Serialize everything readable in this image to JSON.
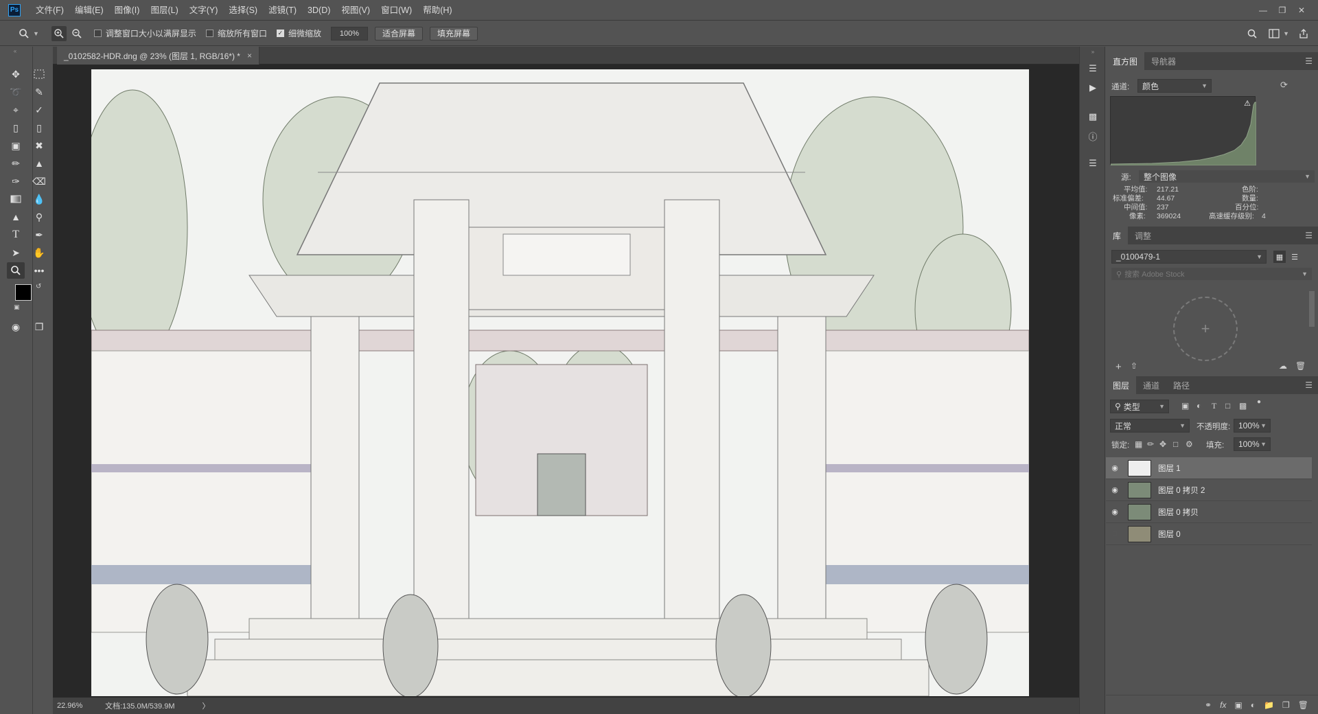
{
  "app": {
    "logo": "Ps"
  },
  "menubar": {
    "items": [
      "文件(F)",
      "编辑(E)",
      "图像(I)",
      "图层(L)",
      "文字(Y)",
      "选择(S)",
      "滤镜(T)",
      "3D(D)",
      "视图(V)",
      "窗口(W)",
      "帮助(H)"
    ]
  },
  "options": {
    "resize_windows": "调整窗口大小以满屏显示",
    "zoom_all": "缩放所有窗口",
    "scrubby_zoom": "细微缩放",
    "zoom_value": "100%",
    "fit_screen": "适合屏幕",
    "fill_screen": "填充屏幕"
  },
  "document": {
    "tab_title": "_0102582-HDR.dng @ 23% (图层 1, RGB/16*) *",
    "close": "×"
  },
  "status": {
    "zoom": "22.96%",
    "doc_size": "文档:135.0M/539.9M",
    "arrow": "〉"
  },
  "histogram_panel": {
    "tabs": [
      "直方图",
      "导航器"
    ],
    "channel_label": "通道:",
    "channel_value": "颜色",
    "source_label": "源:",
    "source_value": "整个图像",
    "stats": {
      "mean_label": "平均值:",
      "mean": "217.21",
      "stddev_label": "标准偏差:",
      "stddev": "44.67",
      "median_label": "中间值:",
      "median": "237",
      "pixels_label": "像素:",
      "pixels": "369024",
      "level_label": "色阶:",
      "count_label": "数量:",
      "percentile_label": "百分位:",
      "cache_label": "高速缓存级别:",
      "cache": "4"
    }
  },
  "library_panel": {
    "tabs": [
      "库",
      "调整"
    ],
    "library_value": "_0100479-1",
    "search_placeholder": "搜索 Adobe Stock",
    "plus": "+"
  },
  "layers_panel": {
    "tabs": [
      "图层",
      "通道",
      "路径"
    ],
    "filter_kind": "类型",
    "blend_mode": "正常",
    "opacity_label": "不透明度:",
    "opacity": "100%",
    "lock_label": "锁定:",
    "fill_label": "填充:",
    "fill": "100%",
    "layers": [
      {
        "name": "图层 1",
        "visible": true,
        "selected": true
      },
      {
        "name": "图层 0 拷贝 2",
        "visible": true,
        "selected": false
      },
      {
        "name": "图层 0 拷贝",
        "visible": true,
        "selected": false
      },
      {
        "name": "图层 0",
        "visible": false,
        "selected": false
      }
    ]
  }
}
